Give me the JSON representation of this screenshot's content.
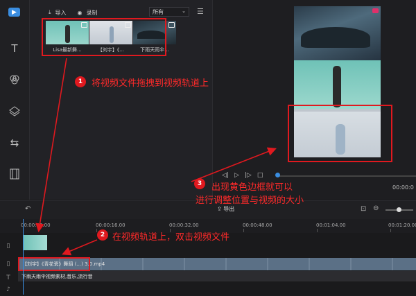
{
  "media_panel": {
    "import_label": "导入",
    "record_label": "录制",
    "filter_value": "所有",
    "items": [
      {
        "caption": "Lisa最新舞..."
      },
      {
        "caption": "【刘宇】《..."
      },
      {
        "caption": "下雨天雨伞..."
      }
    ]
  },
  "preview": {
    "time": "00:00:0"
  },
  "timeline": {
    "export_label": "导出",
    "ticks": [
      "00:00:00.00",
      "00:00:16.00",
      "00:00:32.00",
      "00:00:48.00",
      "00:01:04.00",
      "00:01:20.00"
    ],
    "video_clip_label": "【刘宇】《青花瓷》舞蹈 (...) 3.0.mp4",
    "audio_clip_label": "下雨天雨伞视频素材,音乐,流行音"
  },
  "annotations": {
    "step1": {
      "number": "1",
      "text": "将视频文件拖拽到视频轨道上"
    },
    "step2": {
      "number": "2",
      "text": "在视频轨道上，双击视频文件"
    },
    "step3": {
      "number": "3",
      "line1": "出现黄色边框就可以",
      "line2": "进行调整位置与视频的大小"
    }
  },
  "colors": {
    "accent": "#3a8de0",
    "annotation_red": "#e0191f"
  }
}
